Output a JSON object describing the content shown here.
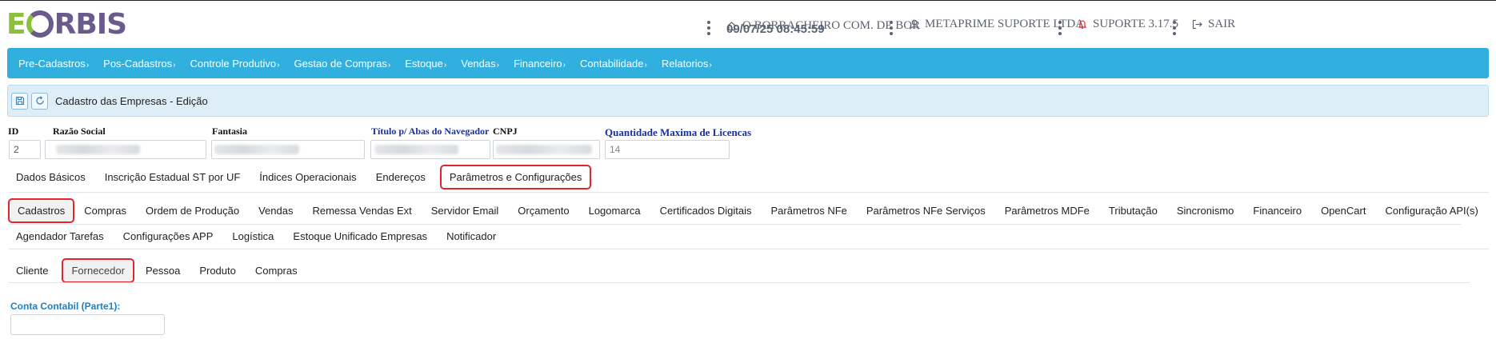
{
  "logo": {
    "e": "E",
    "rest": "RBIS"
  },
  "header": {
    "datetime": "09/07/25 08:45:59",
    "company": "O BORRACHEIRO COM. DE BOR",
    "user": "METAPRIME SUPORTE LTDA",
    "support": "SUPORTE 3.17.5",
    "logout": "SAIR",
    "icons": [
      "home-icon",
      "user-icon",
      "bell-icon",
      "logout-icon"
    ],
    "bell_color": "#e0262b"
  },
  "menu": [
    "Pre-Cadastros",
    "Pos-Cadastros",
    "Controle Produtivo",
    "Gestao de Compras",
    "Estoque",
    "Vendas",
    "Financeiro",
    "Contabilidade",
    "Relatorios"
  ],
  "menu_chevron": "›",
  "toolbar": {
    "title": "Cadastro das Empresas - Edição",
    "icons": [
      "save-icon",
      "refresh-icon"
    ]
  },
  "fields": {
    "id_label": "ID",
    "id_value": "2",
    "razao_label": "Razão Social",
    "fantasia_label": "Fantasia",
    "titulo_label": "Título p/ Abas do Navegador",
    "cnpj_label": "CNPJ",
    "licencas_label": "Quantidade Maxima de Licencas",
    "licencas_value": "14"
  },
  "main_tabs": [
    "Dados Básicos",
    "Inscrição Estadual ST por UF",
    "Índices Operacionais",
    "Endereços",
    "Parâmetros e Configurações"
  ],
  "config_tabs_row1": [
    "Cadastros",
    "Compras",
    "Ordem de Produção",
    "Vendas",
    "Remessa Vendas Ext",
    "Servidor Email",
    "Orçamento",
    "Logomarca",
    "Certificados Digitais",
    "Parâmetros NFe",
    "Parâmetros NFe Serviços",
    "Parâmetros MDFe",
    "Tributação",
    "Sincronismo",
    "Financeiro",
    "OpenCart",
    "Configuração API(s)"
  ],
  "config_tabs_row2": [
    "Agendador Tarefas",
    "Configurações APP",
    "Logística",
    "Estoque Unificado Empresas",
    "Notificador"
  ],
  "sub_tabs": [
    "Cliente",
    "Fornecedor",
    "Pessoa",
    "Produto",
    "Compras"
  ],
  "conta_contabil_label": "Conta Contabil (Parte1):",
  "colors": {
    "menu_bg": "#31b0e0",
    "toolbar_bg": "#ddeef8",
    "highlight": "#e0262b",
    "logo_green": "#8dbf3f",
    "logo_purple": "#6b5b8c"
  }
}
